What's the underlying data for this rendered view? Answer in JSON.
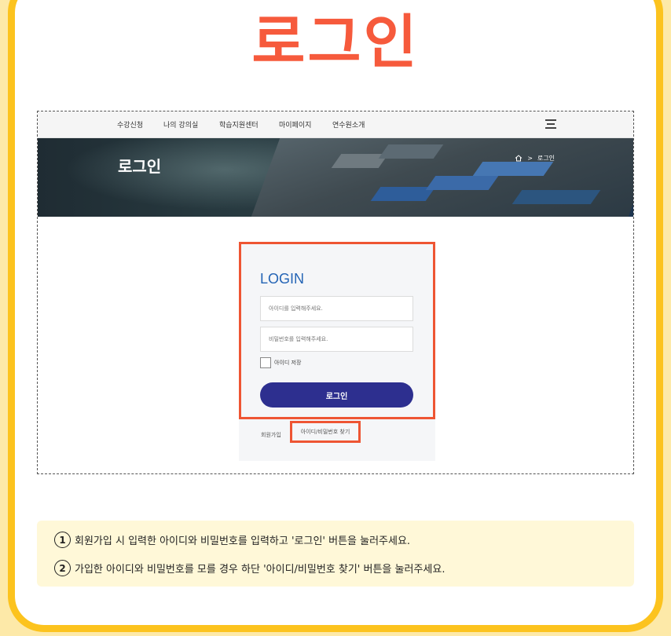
{
  "page_title": "로그인",
  "nav": {
    "items": [
      "수강신청",
      "나의 강의실",
      "학습지원센터",
      "마이페이지",
      "연수원소개"
    ]
  },
  "hero": {
    "title": "로그인",
    "breadcrumb_current": "로그인"
  },
  "login": {
    "title": "LOGIN",
    "id_placeholder": "아이디를 입력해주세요.",
    "password_placeholder": "비밀번호를 입력해주세요.",
    "save_id_label": "아이디 저장",
    "login_button": "로그인",
    "join_link": "회원가입",
    "find_link": "아이디/비밀번호 찾기"
  },
  "notes": [
    {
      "num": "1",
      "text": "회원가입 시 입력한 아이디와 비밀번호를 입력하고 '로그인' 버튼을 눌러주세요."
    },
    {
      "num": "2",
      "text": "가입한 아이디와 비밀번호를 모를 경우 하단 '아이디/비밀번호 찾기' 버튼을 눌러주세요."
    }
  ],
  "colors": {
    "accent_orange": "#f65a3c",
    "frame_yellow": "#fcc31e",
    "login_blue": "#2464b5",
    "button_navy": "#2d2f8f",
    "highlight_red": "#ee5533"
  }
}
